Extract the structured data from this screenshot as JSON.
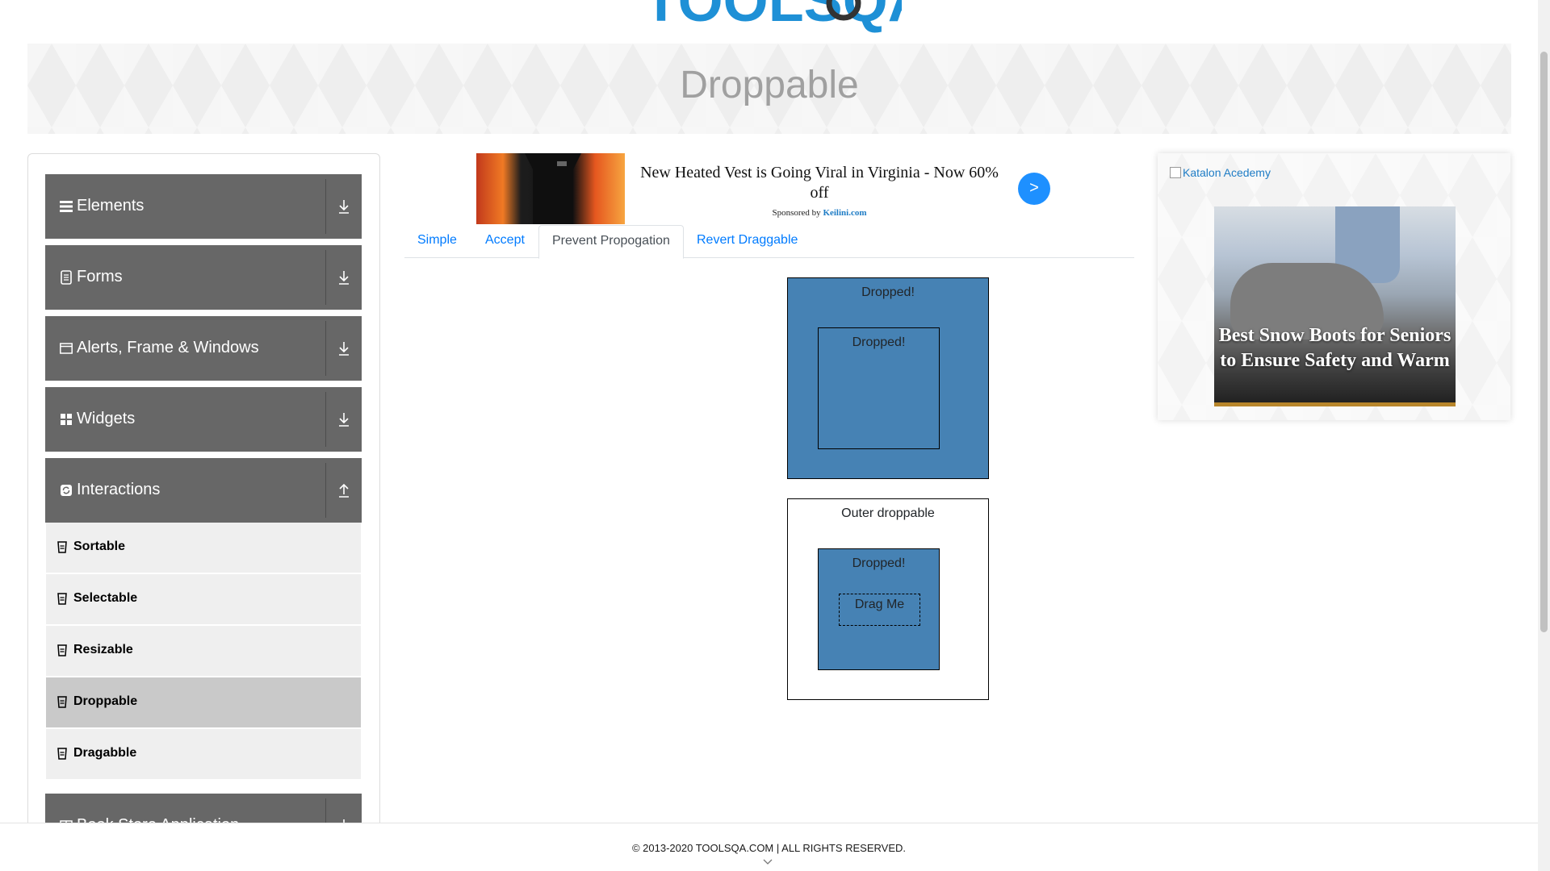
{
  "header": {
    "logo_text": "TOOLSQA"
  },
  "banner": {
    "title": "Droppable"
  },
  "sidebar": {
    "groups": [
      {
        "label": "Elements",
        "icon": "hamburger-icon"
      },
      {
        "label": "Forms",
        "icon": "document-icon"
      },
      {
        "label": "Alerts, Frame & Windows",
        "icon": "window-icon"
      },
      {
        "label": "Widgets",
        "icon": "grid-icon"
      },
      {
        "label": "Interactions",
        "icon": "refresh-icon"
      },
      {
        "label": "Book Store Application",
        "icon": "book-icon"
      }
    ],
    "items": [
      {
        "label": "Sortable"
      },
      {
        "label": "Selectable"
      },
      {
        "label": "Resizable"
      },
      {
        "label": "Droppable",
        "active": true
      },
      {
        "label": "Dragabble"
      }
    ]
  },
  "ad": {
    "headline": "New Heated Vest is Going Viral in Virginia - Now 60% off",
    "sponsored_prefix": "Sponsored by",
    "sponsor": "Keilini.com",
    "button": ">"
  },
  "tabs": [
    {
      "label": "Simple"
    },
    {
      "label": "Accept"
    },
    {
      "label": "Prevent Propogation",
      "active": true
    },
    {
      "label": "Revert Draggable"
    }
  ],
  "droppables": {
    "outer1": "Dropped!",
    "inner1": "Dropped!",
    "outer2": "Outer droppable",
    "inner2": "Dropped!",
    "drag": "Drag Me"
  },
  "right_ad": {
    "link_alt": "Katalon Acedemy",
    "caption": "Best Snow Boots for Seniors to Ensure Safety and Warm"
  },
  "footer": {
    "copyright": "© 2013-2020 TOOLSQA.COM | ALL RIGHTS RESERVED."
  },
  "colors": {
    "accent": "#007bff",
    "group_bg": "#676767",
    "droppable_blue": "#4682b4"
  }
}
